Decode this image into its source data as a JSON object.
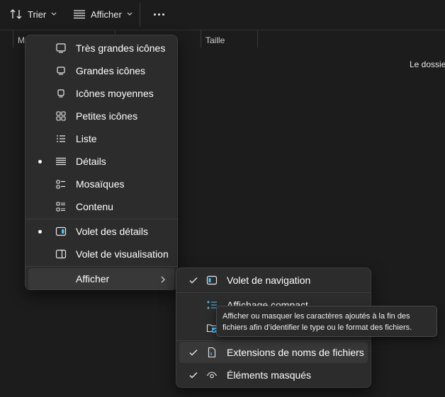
{
  "toolbar": {
    "sort_label": "Trier",
    "view_label": "Afficher",
    "sort_icon": "sort-arrows-icon",
    "view_icon": "lines-icon",
    "more_icon": "more-dots-icon"
  },
  "columns": {
    "first_partial": "M",
    "size": "Taille"
  },
  "content": {
    "empty_message_partial": "Le dossier"
  },
  "view_menu": {
    "items": [
      {
        "label": "Très grandes icônes",
        "icon": "monitor-icon",
        "selected": false
      },
      {
        "label": "Grandes icônes",
        "icon": "monitor-icon",
        "selected": false
      },
      {
        "label": "Icônes moyennes",
        "icon": "small-monitor-icon",
        "selected": false
      },
      {
        "label": "Petites icônes",
        "icon": "grid-icon",
        "selected": false
      },
      {
        "label": "Liste",
        "icon": "list-icon",
        "selected": false
      },
      {
        "label": "Détails",
        "icon": "details-icon",
        "selected": true
      },
      {
        "label": "Mosaïques",
        "icon": "tiles-icon",
        "selected": false
      },
      {
        "label": "Contenu",
        "icon": "content-icon",
        "selected": false
      }
    ],
    "panes": [
      {
        "label": "Volet des détails",
        "icon": "details-pane-icon",
        "selected": true
      },
      {
        "label": "Volet de visualisation",
        "icon": "preview-pane-icon",
        "selected": false
      }
    ],
    "show_label": "Afficher"
  },
  "show_submenu": {
    "items": [
      {
        "label": "Volet de navigation",
        "icon": "navigation-pane-icon",
        "checked": true
      },
      {
        "label": "Affichage compact",
        "icon": "compact-icon",
        "checked": false
      },
      {
        "label": "",
        "icon": "checkbox-folder-icon",
        "checked": false
      },
      {
        "label": "Extensions de noms de fichiers",
        "icon": "file-extension-icon",
        "checked": true
      },
      {
        "label": "Éléments masqués",
        "icon": "eye-icon",
        "checked": true
      }
    ]
  },
  "tooltip": {
    "text": "Afficher ou masquer les caractères ajoutés à la fin des fichiers afin d’identifier le type ou le format des fichiers."
  },
  "colors": {
    "background": "#1c1c1c",
    "menu_bg": "#2c2c2c",
    "hover_bg": "#383838",
    "accent": "#4cc2ff"
  }
}
